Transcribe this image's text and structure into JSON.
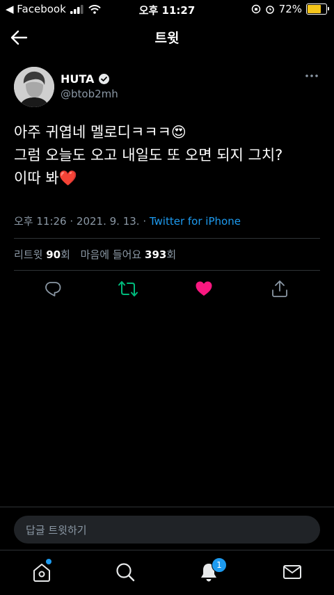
{
  "status_bar": {
    "back_app": "◀ Facebook",
    "time": "오후 11:27",
    "battery_percent": "72%",
    "battery_level": 0.72
  },
  "nav": {
    "title": "트윗"
  },
  "author": {
    "name": "HUTA",
    "handle": "@btob2mh",
    "verified": true
  },
  "tweet": {
    "text": "아주 귀엽네 멜로디ㅋㅋㅋ😍\n그럼 오늘도 오고 내일도 또 오면 되지 그치?\n이따 봐❤️",
    "timestamp": "오후 11:26 · 2021. 9. 13. · ",
    "source": "Twitter for iPhone"
  },
  "stats": {
    "retweet_label": "리트윗",
    "retweet_count": "90",
    "retweet_suffix": "회",
    "like_label": "마음에 들어요",
    "like_count": "393",
    "like_suffix": "회"
  },
  "actions": {
    "reply_icon": "comment-icon",
    "retweet_icon": "retweet-icon",
    "like_icon": "heart-icon",
    "share_icon": "share-icon",
    "retweet_color": "#00ba7c",
    "like_color": "#f91880"
  },
  "reply": {
    "placeholder": "답글 트윗하기"
  },
  "tabbar": {
    "notifications_badge": "1"
  },
  "colors": {
    "accent": "#1d9bf0",
    "background": "#000000"
  }
}
